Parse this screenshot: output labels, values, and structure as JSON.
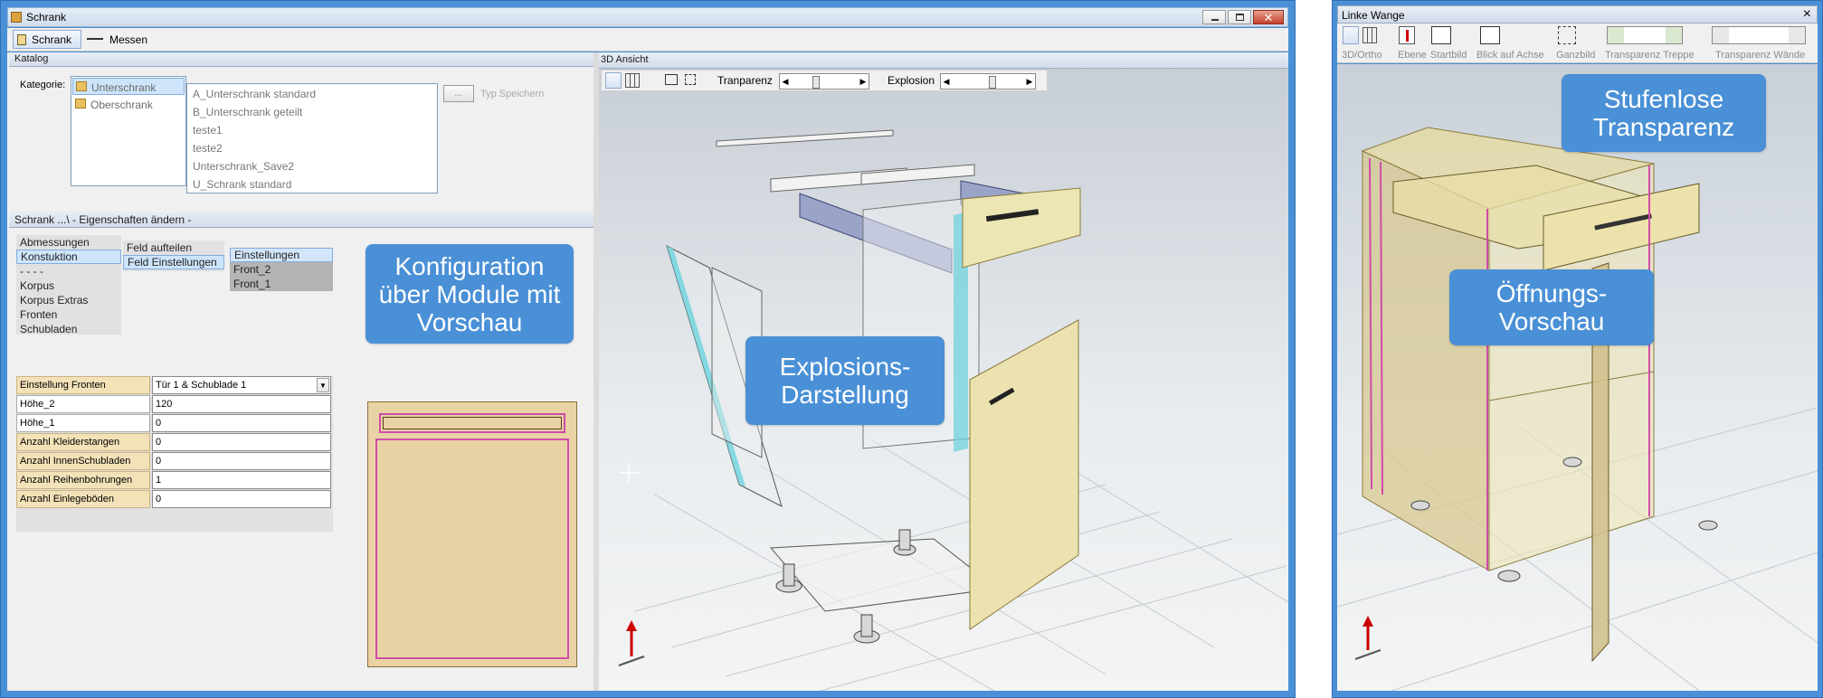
{
  "main_window": {
    "title": "Schrank",
    "toolbar": {
      "schrank_tab": "Schrank",
      "messen_tab": "Messen"
    }
  },
  "katalog": {
    "header": "Katalog",
    "kategorie_label": "Kategorie:",
    "categories": [
      "Unterschrank",
      "Oberschrank"
    ],
    "items": [
      "A_Unterschrank standard",
      "B_Unterschrank geteilt",
      "teste1",
      "teste2",
      "Unterschrank_Save2",
      "U_Schrank standard"
    ],
    "browse_button": "...",
    "save_type_label": "Typ Speichern"
  },
  "eigenschaften": {
    "header": "Schrank ...\\  -  Eigenschaften ändern -",
    "nav": [
      "Abmessungen",
      "Konstuktion",
      "- - - -",
      "Korpus",
      "Korpus Extras",
      "Fronten",
      "Schubladen"
    ],
    "feld_options": [
      "Feld aufteilen",
      "Feld Einstellungen"
    ],
    "einstellungen": [
      "Einstellungen",
      "Front_2",
      "Front_1"
    ],
    "properties": [
      {
        "label": "Einstellung Fronten",
        "value": "Tür 1 & Schublade 1",
        "dropdown": true
      },
      {
        "label": "Höhe_2",
        "value": "120"
      },
      {
        "label": "Höhe_1",
        "value": "0"
      },
      {
        "label": "Anzahl Kleiderstangen",
        "value": "0"
      },
      {
        "label": "Anzahl InnenSchubladen",
        "value": "0"
      },
      {
        "label": "Anzahl Reihenbohrungen",
        "value": "1"
      },
      {
        "label": "Anzahl Einlegeböden",
        "value": "0"
      }
    ]
  },
  "view3d": {
    "header": "3D Ansicht",
    "transparency_label": "Tranparenz",
    "explosion_label": "Explosion",
    "transparency_level": 0.35,
    "explosion_level": 0.55
  },
  "callouts": {
    "konfiguration": "Konfiguration über Module mit Vorschau",
    "explosion": "Explosions-Darstellung",
    "stufenlos": "Stufenlose Transparenz",
    "oeffnung": "Öffnungs-Vorschau"
  },
  "right_window": {
    "title": "Linke Wange",
    "close": "×",
    "tools": [
      "3D/Ortho",
      "Ebene",
      "Startbild",
      "Blick auf Achse",
      "Ganzbild",
      "Transparenz Treppe",
      "Transparenz Wände"
    ]
  },
  "colors": {
    "frame_blue": "#4a90d6",
    "panel_beige": "#e8d9a6",
    "drawer_yellow": "#ece6b4",
    "accent_magenta": "#d04ca8",
    "cyan_edge": "#6dd3dd"
  }
}
